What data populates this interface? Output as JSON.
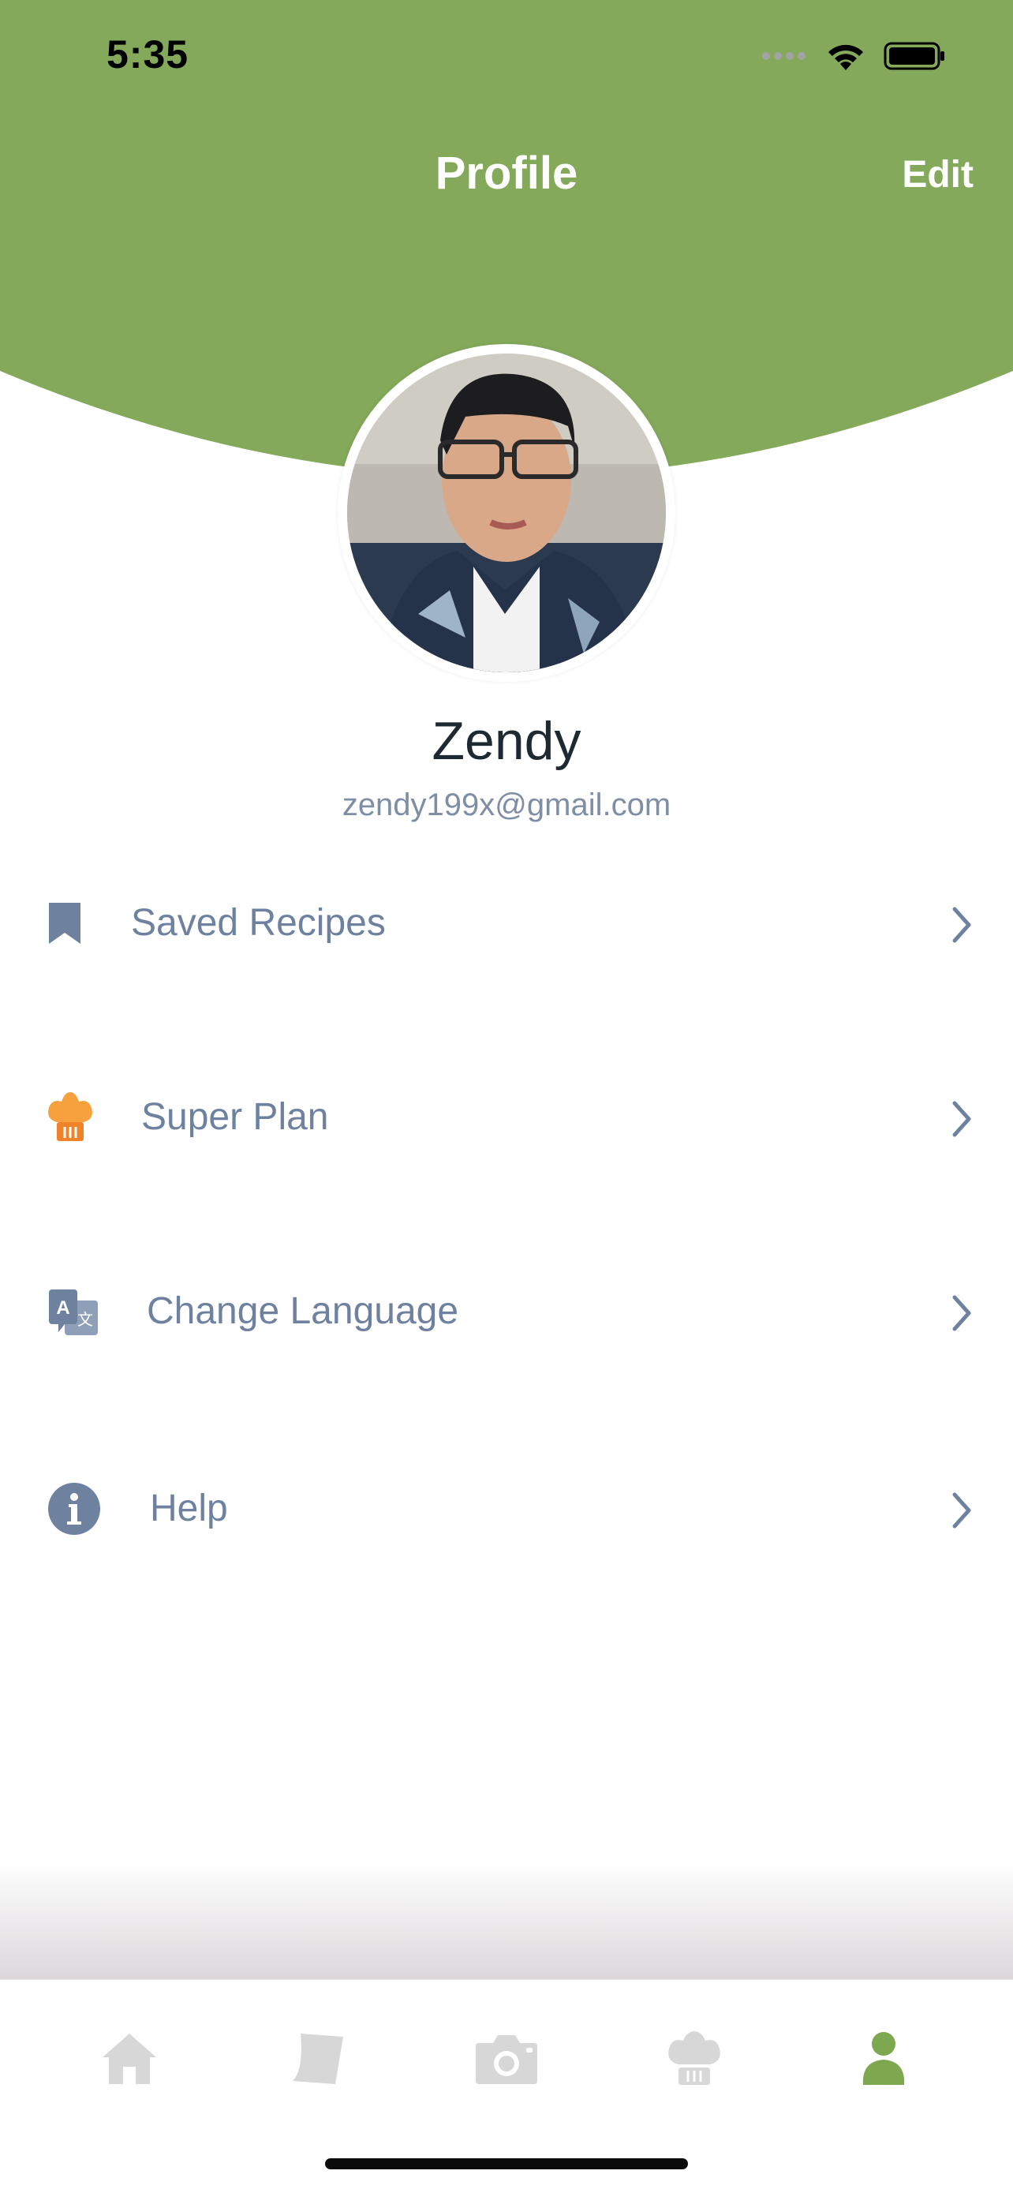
{
  "status_bar": {
    "time": "5:35"
  },
  "header": {
    "title": "Profile",
    "edit_label": "Edit"
  },
  "profile": {
    "name": "Zendy",
    "email": "zendy199x@gmail.com"
  },
  "menu": [
    {
      "label": "Saved Recipes",
      "icon": "bookmark-icon"
    },
    {
      "label": "Super Plan",
      "icon": "chef-hat-icon"
    },
    {
      "label": "Change Language",
      "icon": "translate-icon"
    },
    {
      "label": "Help",
      "icon": "info-icon"
    }
  ],
  "tabs": [
    {
      "icon": "home-icon"
    },
    {
      "icon": "recipe-card-icon"
    },
    {
      "icon": "camera-icon"
    },
    {
      "icon": "chef-hat-icon"
    },
    {
      "icon": "user-icon",
      "active": true
    }
  ],
  "colors": {
    "brand_green": "#84a95b",
    "menu_text": "#6e82a0",
    "tab_inactive": "#d7d7d7",
    "tab_active": "#7ea850",
    "super_plan_orange": "#f6a13e"
  }
}
